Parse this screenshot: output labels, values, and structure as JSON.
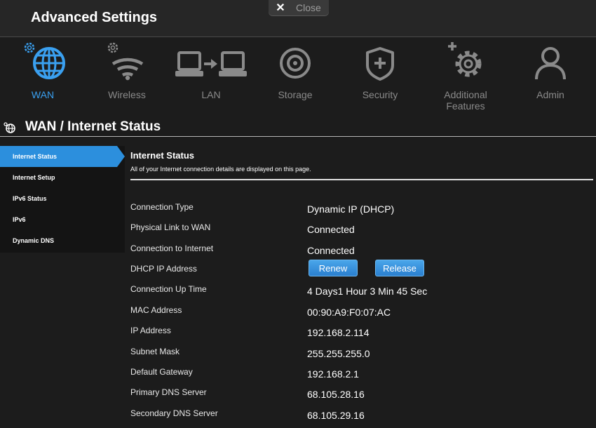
{
  "header": {
    "title": "Advanced Settings",
    "close_label": "Close"
  },
  "nav": [
    {
      "label": "WAN",
      "icon": "globe-icon"
    },
    {
      "label": "Wireless",
      "icon": "wifi-icon"
    },
    {
      "label": "LAN",
      "icon": "lan-icon"
    },
    {
      "label": "Storage",
      "icon": "storage-icon"
    },
    {
      "label": "Security",
      "icon": "shield-icon"
    },
    {
      "label": "Additional Features",
      "icon": "gear-plus-icon"
    },
    {
      "label": "Admin",
      "icon": "user-icon"
    }
  ],
  "section": {
    "title": "WAN / Internet Status"
  },
  "sidebar": [
    {
      "label": "Internet Status"
    },
    {
      "label": "Internet Setup"
    },
    {
      "label": "IPv6 Status"
    },
    {
      "label": "IPv6"
    },
    {
      "label": "Dynamic DNS"
    }
  ],
  "panel": {
    "title": "Internet Status",
    "description": "All of your Internet connection details are displayed on this page."
  },
  "rows": [
    {
      "label": "Connection Type",
      "value": "Dynamic IP (DHCP)"
    },
    {
      "label": "Physical Link to WAN",
      "value": "Connected"
    },
    {
      "label": "Connection to Internet",
      "value": "Connected"
    },
    {
      "label": "DHCP IP Address",
      "value": ""
    },
    {
      "label": "Connection Up Time",
      "value": "4 Days1 Hour 3 Min 45 Sec"
    },
    {
      "label": "MAC Address",
      "value": "00:90:A9:F0:07:AC"
    },
    {
      "label": "IP Address",
      "value": "192.168.2.114"
    },
    {
      "label": "Subnet Mask",
      "value": "255.255.255.0"
    },
    {
      "label": "Default Gateway",
      "value": "192.168.2.1"
    },
    {
      "label": "Primary DNS Server",
      "value": "68.105.28.16"
    },
    {
      "label": "Secondary DNS Server",
      "value": "68.105.29.16"
    }
  ],
  "dhcp_buttons": {
    "renew": "Renew",
    "release": "Release"
  },
  "colors": {
    "accent": "#3aa0f0",
    "background": "#1c1c1c",
    "inactive_icon": "#8a8a8a"
  }
}
